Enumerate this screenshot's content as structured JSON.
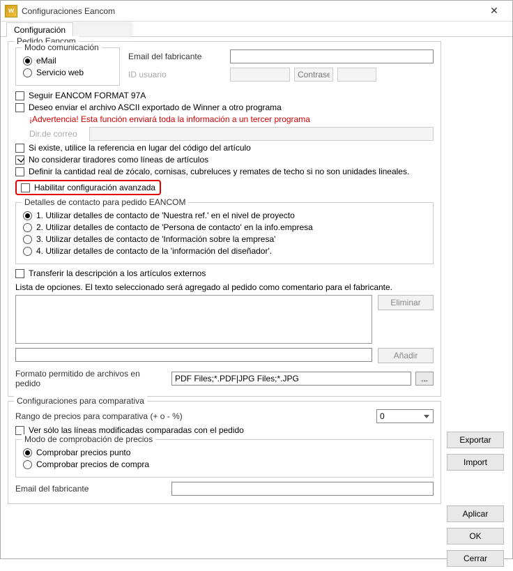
{
  "window": {
    "title": "Configuraciones Eancom"
  },
  "tabs": {
    "active": "Configuración"
  },
  "group_pedido": {
    "legend": "Pedido Eancom"
  },
  "group_modo": {
    "legend": "Modo comunicación",
    "email": "eMail",
    "web": "Servicio web"
  },
  "email_label": "Email del fabricante",
  "id_usuario_label": "ID usuario",
  "contrasena_placeholder": "Contraseña",
  "chk_format97a": "Seguir EANCOM FORMAT 97A",
  "chk_export_ascii": "Deseo enviar el archivo ASCII exportado de Winner a otro programa",
  "warning_text": "¡Advertencia! Esta función enviará toda la información a un tercer programa",
  "dir_correo_label": "Dir.de correo",
  "chk_ref_articulo": "Si existe, utilice la referencia  en lugar del código del artículo",
  "chk_no_tiradores": "No considerar tiradores como líneas de artículos",
  "chk_definir_cantidad": "Definir la cantidad real de zócalo, cornisas, cubreluces y remates de techo si no son unidades lineales.",
  "chk_habilitar_avanzada": "Habilitar configuración avanzada",
  "group_contacto": {
    "legend": "Detalles de contacto para pedido EANCOM",
    "opt1": "1. Utilizar detalles de contacto de 'Nuestra ref.' en el nivel de proyecto",
    "opt2": "2. Utilizar detalles de contacto de 'Persona de contacto' en la info.empresa",
    "opt3": "3. Utilizar detalles de contacto de 'Información sobre la empresa'",
    "opt4": "4. Utilizar detalles de contacto de la 'información del diseñador'."
  },
  "chk_transferir_desc": "Transferir la descripción a los artículos externos",
  "lista_opciones_label": "Lista de opciones. El texto seleccionado será agregado al pedido como comentario para el fabricante.",
  "btn_eliminar": "Eliminar",
  "btn_anadir": "Añadir",
  "formato_label": "Formato permitido de archivos en pedido",
  "formato_value": "PDF Files;*.PDF|JPG Files;*.JPG",
  "group_comparativa": {
    "legend": "Configuraciones para comparativa",
    "rango_label": "Rango de precios para comparativa (+ o - %)",
    "rango_value": "0",
    "chk_ver_modificadas": "Ver sólo las líneas modificadas comparadas con el pedido"
  },
  "group_modo_precios": {
    "legend": "Modo de comprobación de precios",
    "opt_punto": "Comprobar precios punto",
    "opt_compra": "Comprobar precios de compra"
  },
  "email_fabricante2_label": "Email del fabricante",
  "side": {
    "exportar": "Exportar",
    "import": "Import",
    "aplicar": "Aplicar",
    "ok": "OK",
    "cerrar": "Cerrar"
  }
}
